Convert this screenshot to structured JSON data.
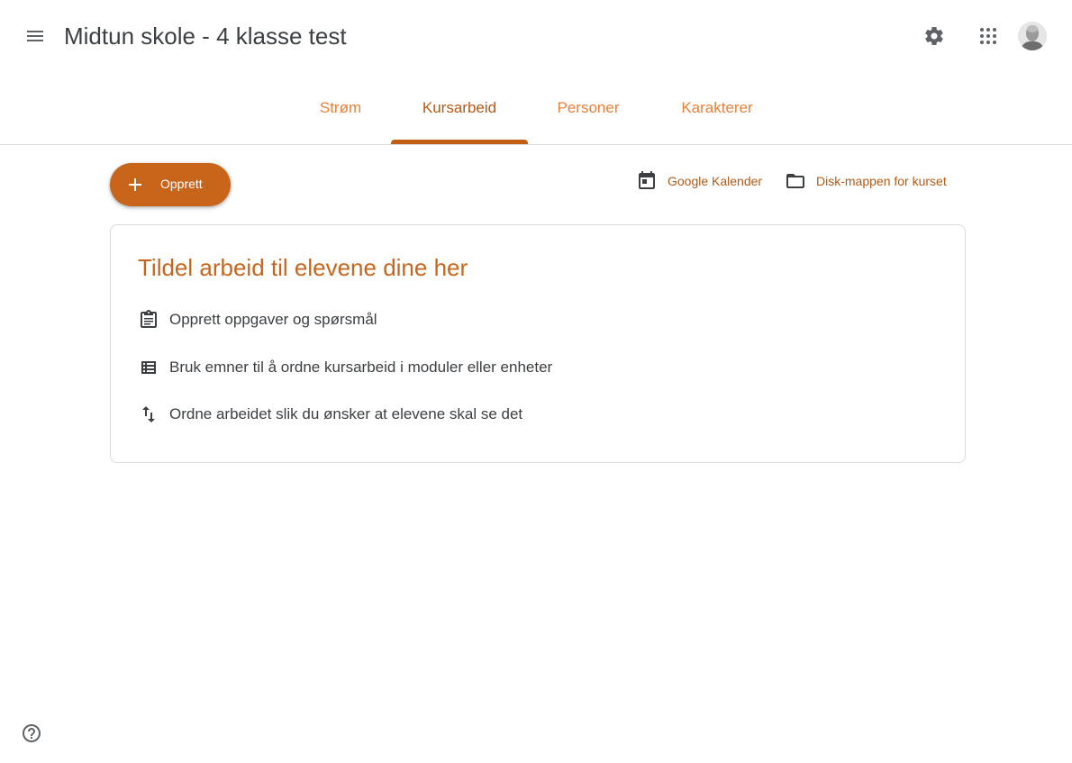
{
  "header": {
    "title": "Midtun skole - 4 klasse test",
    "menu_icon": "hamburger-menu-icon",
    "settings_icon": "gear-icon",
    "apps_icon": "apps-grid-icon",
    "avatar": "user-avatar"
  },
  "tabs": [
    {
      "label": "Strøm",
      "active": false
    },
    {
      "label": "Kursarbeid",
      "active": true
    },
    {
      "label": "Personer",
      "active": false
    },
    {
      "label": "Karakterer",
      "active": false
    }
  ],
  "toolbar": {
    "create_label": "Opprett",
    "calendar_label": "Google Kalender",
    "drive_label": "Disk-mappen for kurset"
  },
  "empty_state": {
    "title": "Tildel arbeid til elevene dine her",
    "tips": [
      {
        "icon": "assignment-icon",
        "text": "Opprett oppgaver og spørsmål"
      },
      {
        "icon": "topic-list-icon",
        "text": "Bruk emner til å ordne kursarbeid i moduler eller enheter"
      },
      {
        "icon": "reorder-arrows-icon",
        "text": "Ordne arbeidet slik du ønsker at elevene skal se det"
      }
    ]
  },
  "colors": {
    "accent": "#c8651b",
    "accent_text": "#b55a14",
    "tab_text": "#e8803a",
    "text": "#3c4043",
    "border": "#dadce0"
  }
}
